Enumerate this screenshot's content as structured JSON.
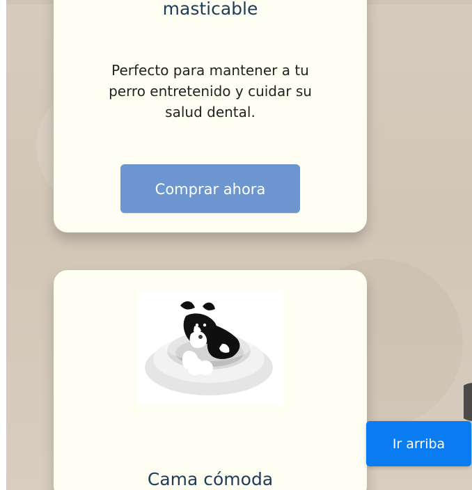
{
  "cards": [
    {
      "title": "masticable",
      "description": "Perfecto para mantener a tu perro entretenido y cuidar su salud dental.",
      "button_label": "Comprar ahora"
    },
    {
      "image_alt": "dog-on-bed-image",
      "title": "Cama cómoda"
    }
  ],
  "floating": {
    "scroll_top_label": "Ir arriba"
  },
  "colors": {
    "background": "#d6cbbd",
    "card": "#fffef2",
    "title": "#1f3b5a",
    "buy_button": "#6d95cf",
    "scroll_top_button": "#0a7cf2"
  }
}
